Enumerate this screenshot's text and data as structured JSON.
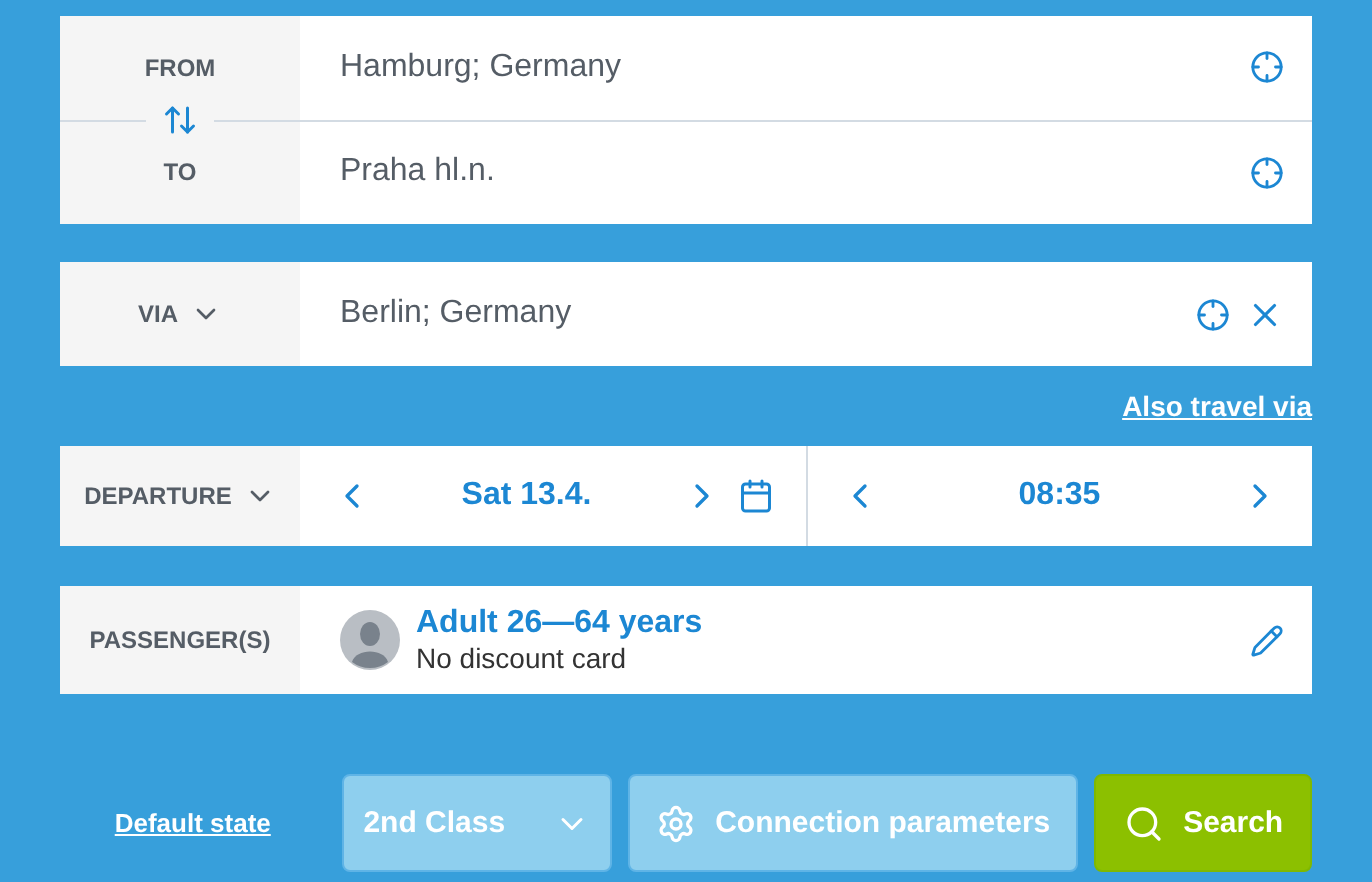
{
  "from": {
    "label": "FROM",
    "value": "Hamburg; Germany"
  },
  "to": {
    "label": "TO",
    "value": "Praha hl.n."
  },
  "via": {
    "label": "VIA",
    "value": "Berlin; Germany"
  },
  "also_travel_via": "Also travel via",
  "departure": {
    "label": "DEPARTURE",
    "date": "Sat 13.4.",
    "time": "08:35"
  },
  "passenger": {
    "label": "PASSENGER(S)",
    "title": "Adult 26—64 years",
    "subtitle": "No discount card"
  },
  "footer": {
    "default_state": "Default state",
    "class": "2nd Class",
    "parameters": "Connection parameters",
    "search": "Search"
  }
}
